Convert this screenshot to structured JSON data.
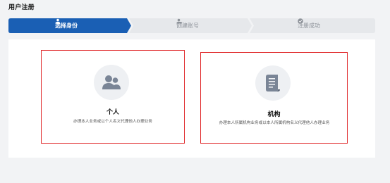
{
  "page": {
    "title": "用户注册"
  },
  "steps": [
    {
      "label": "选择身份",
      "icon": "user-icon",
      "state": "active"
    },
    {
      "label": "创建账号",
      "icon": "user-badge-icon",
      "state": "pending"
    },
    {
      "label": "注册成功",
      "icon": "check-circle-icon",
      "state": "pending"
    }
  ],
  "identity_options": [
    {
      "title": "个人",
      "icon": "people-icon",
      "description": "办理本人业务或以个人名义代理他人办理业务"
    },
    {
      "title": "机构",
      "icon": "document-icon",
      "description": "办理本人所属机构业务或以本人所属机构名义代理他人办理业务"
    }
  ],
  "colors": {
    "active_step": "#1a5fb4",
    "inactive_step": "#e6e8eb",
    "highlight_border": "#e0282a",
    "background": "#f2f3f5",
    "icon_gray": "#7a8596"
  }
}
